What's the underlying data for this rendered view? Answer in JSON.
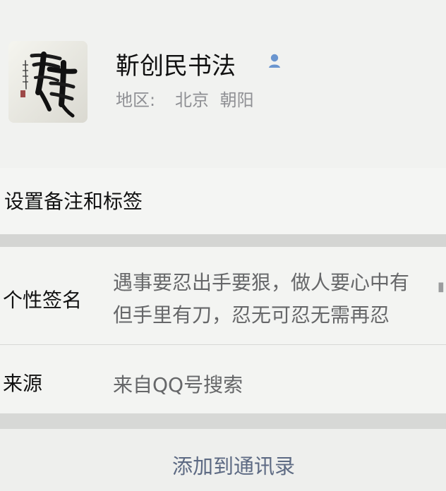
{
  "profile": {
    "name": "靳创民书法",
    "verified_icon": "person-badge-icon",
    "avatar": {
      "description_icon": "calligraphy-avatar",
      "calligraphy_char": "静"
    },
    "region_label": "地区:",
    "region_value": "北京  朝阳"
  },
  "actions": {
    "set_remark": "设置备注和标签",
    "add_contact": "添加到通讯录"
  },
  "details": {
    "signature_label": "个性签名",
    "signature_line_1": "遇事要忍出手要狠，做人要心中有",
    "signature_line_2": "但手里有刀，忍无可忍无需再忍",
    "source_label": "来源",
    "source_value": "来自QQ号搜索"
  },
  "colors": {
    "background": "#e7e8e6",
    "title": "#111111",
    "muted": "#8f9094",
    "body": "#666769",
    "accent": "#5d6a83",
    "verify_blue": "#6a95cf"
  }
}
